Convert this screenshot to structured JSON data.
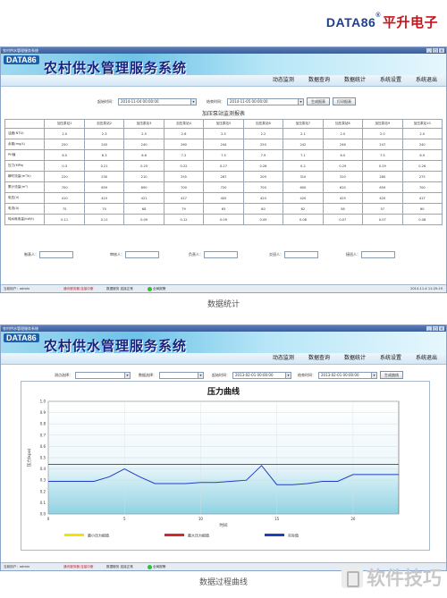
{
  "brand": {
    "en": "DATA86",
    "reg": "®",
    "cn": "平升电子"
  },
  "window1": {
    "titlebar": "农村供水管理服务系统",
    "logo": "DATA86",
    "app_title": "农村供水管理服务系统",
    "menu": [
      "动态监测",
      "数据查询",
      "数据统计",
      "系统设置",
      "系统退出"
    ],
    "filters": {
      "start_label": "起始时间：",
      "start_value": "2014-11-04 00:00:00",
      "end_label": "结束时间：",
      "end_value": "2014-11-05 00:00:00",
      "generate_button": "生成报表",
      "print_button": "打印报表"
    },
    "report_title": "加压泵站监测报表",
    "table": {
      "columns": [
        "",
        "加压泵站1",
        "加压泵站2",
        "加压泵站3",
        "加压泵站4",
        "加压泵站5",
        "加压泵站6",
        "加压泵站7",
        "加压泵站8",
        "加压泵站9",
        "加压泵站10"
      ],
      "rows": [
        [
          "浊度(NTU)",
          "2.0",
          "2.3",
          "2.5",
          "2.6",
          "2.5",
          "2.2",
          "2.1",
          "2.0",
          "2.0",
          "2.0"
        ],
        [
          "余氯(mg/L)",
          "250",
          "245",
          "240",
          "260",
          "244",
          "250",
          "242",
          "246",
          "247",
          "240"
        ],
        [
          "PH值",
          "6.5",
          "6.3",
          "6.6",
          "7.2",
          "7.5",
          "7.9",
          "7.1",
          "6.0",
          "7.5",
          "6.9"
        ],
        [
          "压力(MPa)",
          "0.3",
          "0.21",
          "0.25",
          "0.22",
          "0.27",
          "0.26",
          "0.2",
          "0.29",
          "0.29",
          "0.26"
        ],
        [
          "瞬时流量(m³/h)",
          "220",
          "230",
          "210",
          "255",
          "287",
          "209",
          "310",
          "310",
          "280",
          "275"
        ],
        [
          "累计流量(m³)",
          "700",
          "659",
          "690",
          "700",
          "720",
          "700",
          "600",
          "620",
          "659",
          "700"
        ],
        [
          "电压(V)",
          "410",
          "415",
          "421",
          "417",
          "405",
          "420",
          "420",
          "425",
          "420",
          "417"
        ],
        [
          "电流(A)",
          "75",
          "70",
          "68",
          "79",
          "63",
          "60",
          "62",
          "58",
          "57",
          "60"
        ],
        [
          "吨水耗电量(kW/t)",
          "0.11",
          "0.11",
          "0.09",
          "0.12",
          "0.09",
          "0.09",
          "0.08",
          "0.07",
          "0.07",
          "0.08"
        ]
      ]
    },
    "signatures": [
      "制表人：",
      "审核人：",
      "负责人：",
      "交班人：",
      "接班人："
    ],
    "status": {
      "user": "当前用户：admin",
      "alarm": "通讯服务器 连接中断",
      "db": "数据服务 连接正常",
      "ok": "全局报警",
      "time": "2014-11-4 11:25:19"
    }
  },
  "caption1": "数据统计",
  "window2": {
    "titlebar": "农村供水管理服务系统",
    "logo": "DATA86",
    "app_title": "农村供水管理服务系统",
    "menu": [
      "动态监测",
      "数据查询",
      "数据统计",
      "系统设置",
      "系统退出"
    ],
    "filters": {
      "site_label": "测点选择：",
      "site_value": "",
      "type_label": "数据选择：",
      "type_value": "",
      "start_label": "起始时间：",
      "start_value": "2013-02-01 00:00:00",
      "end_label": "结束时间：",
      "end_value": "2013-02-01 00:00:00",
      "generate_button": "生成曲线"
    },
    "status": {
      "user": "当前用户：admin",
      "alarm": "通讯服务器 连接中断",
      "db": "数据服务 连接正常",
      "ok": "全局报警"
    }
  },
  "caption2": "数据过程曲线",
  "watermark": "软件技巧",
  "chart_data": {
    "type": "line",
    "title": "压力曲线",
    "xlabel": "时间",
    "ylabel": "压力(kpa)",
    "xlim": [
      0,
      23
    ],
    "ylim": [
      0,
      1
    ],
    "xticks": [
      0,
      5,
      10,
      15,
      20
    ],
    "yticks": [
      0,
      0.1,
      0.2,
      0.3,
      0.4,
      0.5,
      0.6,
      0.7,
      0.8,
      0.9,
      1.0
    ],
    "grid": true,
    "series": [
      {
        "name": "最小压力报值",
        "color": "#f2e400",
        "x": [],
        "values": []
      },
      {
        "name": "最大压力报值",
        "color": "#d8262e",
        "x": [
          0,
          23
        ],
        "values": [
          0.44,
          0.44
        ]
      },
      {
        "name": "实际值",
        "color": "#1e3fc4",
        "x": [
          0,
          1,
          2,
          3,
          4,
          5,
          6,
          7,
          8,
          9,
          10,
          11,
          12,
          13,
          14,
          15,
          16,
          17,
          18,
          19,
          20,
          21,
          22,
          23
        ],
        "values": [
          0.29,
          0.29,
          0.29,
          0.29,
          0.33,
          0.4,
          0.33,
          0.27,
          0.27,
          0.27,
          0.28,
          0.28,
          0.29,
          0.3,
          0.43,
          0.26,
          0.26,
          0.27,
          0.29,
          0.29,
          0.35,
          0.35,
          0.35,
          0.35
        ]
      }
    ],
    "legend_position": "bottom"
  }
}
